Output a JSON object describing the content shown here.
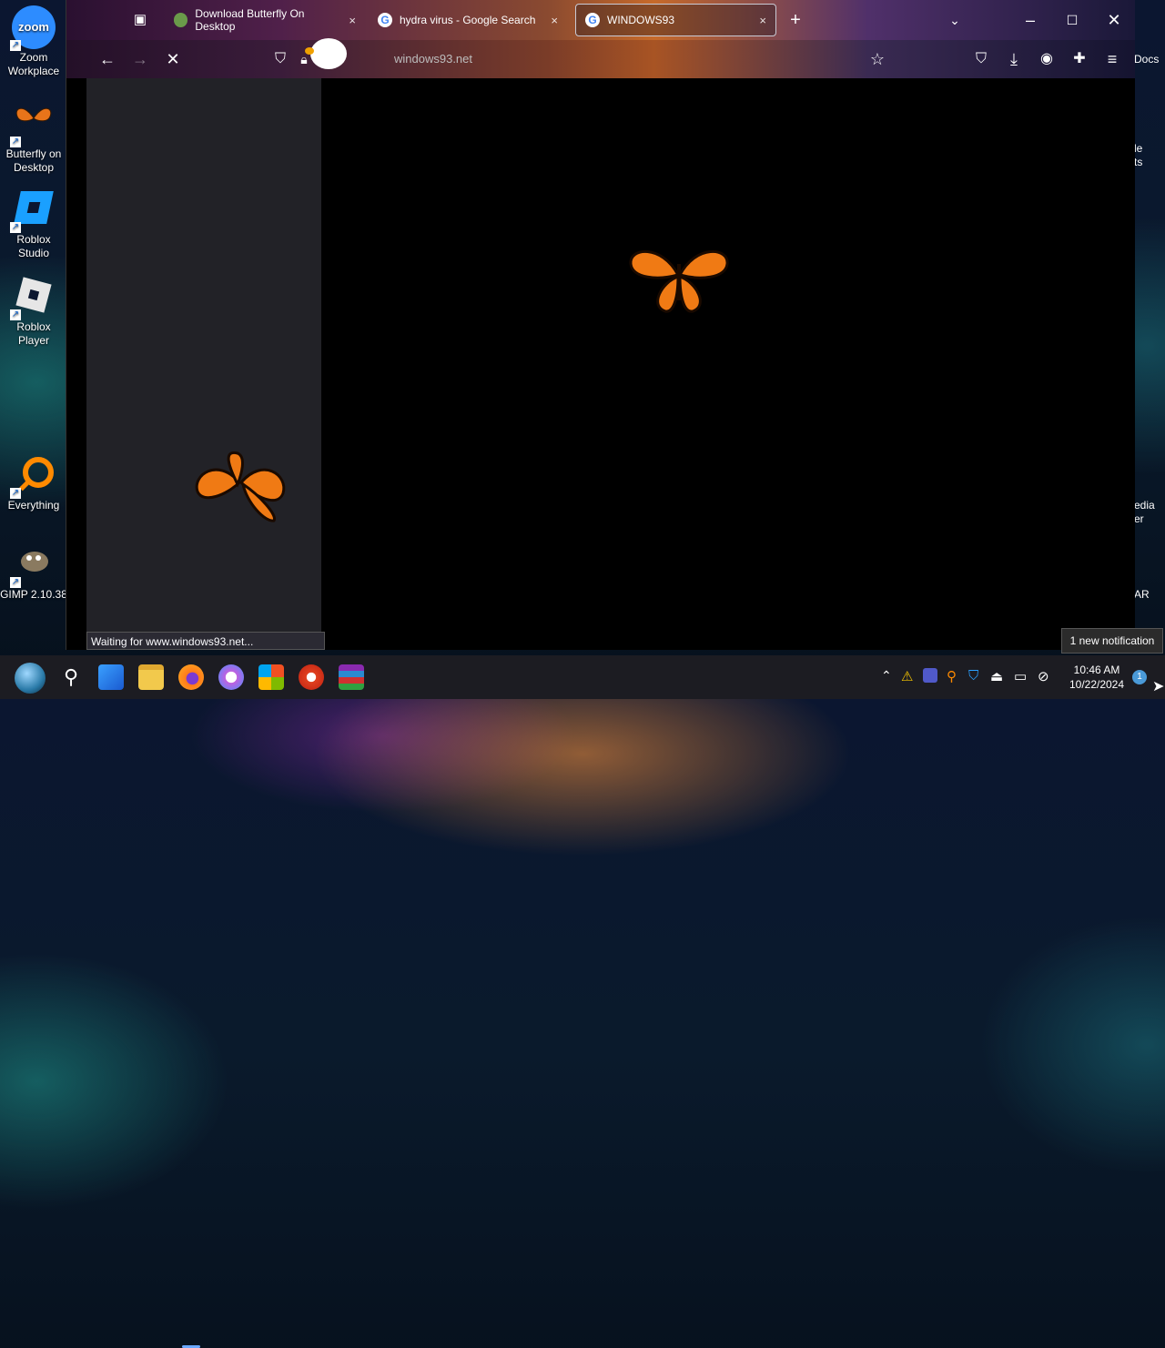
{
  "desktop": {
    "icons": [
      {
        "label": "Zoom\nWorkplace",
        "icon": "zoom-icon",
        "color": "#2d8cff"
      },
      {
        "label": "Butterfly on\nDesktop",
        "icon": "butterfly-icon",
        "color": "#e8741a"
      },
      {
        "label": "Roblox\nStudio",
        "icon": "roblox-studio-icon",
        "color": "#1aa0ff"
      },
      {
        "label": "Roblox\nPlayer",
        "icon": "roblox-player-icon",
        "color": "#e6e6e6"
      },
      {
        "label": "Everything",
        "icon": "everything-search-icon",
        "color": "#ff8a00"
      },
      {
        "label": "GIMP 2.10.38",
        "icon": "gimp-icon",
        "color": "#8a7a60"
      }
    ],
    "right_partial": [
      "Docs",
      "le\nts",
      "edia\ner",
      "AR"
    ]
  },
  "browser": {
    "tabs": [
      {
        "label": "Download Butterfly On Desktop",
        "favicon": "butterfly-favicon"
      },
      {
        "label": "hydra virus - Google Search",
        "favicon": "google-favicon"
      },
      {
        "label": "WINDOWS93",
        "favicon": "google-favicon",
        "active": true
      }
    ],
    "url": "https://www.windows93.net",
    "url_visible": "windows93.net",
    "status_text": "Waiting for www.windows93.net...",
    "accent": "#c76a2a"
  },
  "taskbar": {
    "time": "10:46 AM",
    "date": "10/22/2024",
    "notification_badge": "1",
    "apps": [
      "start-orb-icon",
      "search-icon",
      "widgets-icon",
      "file-explorer-icon",
      "firefox-icon",
      "itunes-icon",
      "store-icon",
      "ccleaner-icon",
      "winrar-icon"
    ]
  },
  "notification": {
    "text": "1 new notification"
  }
}
